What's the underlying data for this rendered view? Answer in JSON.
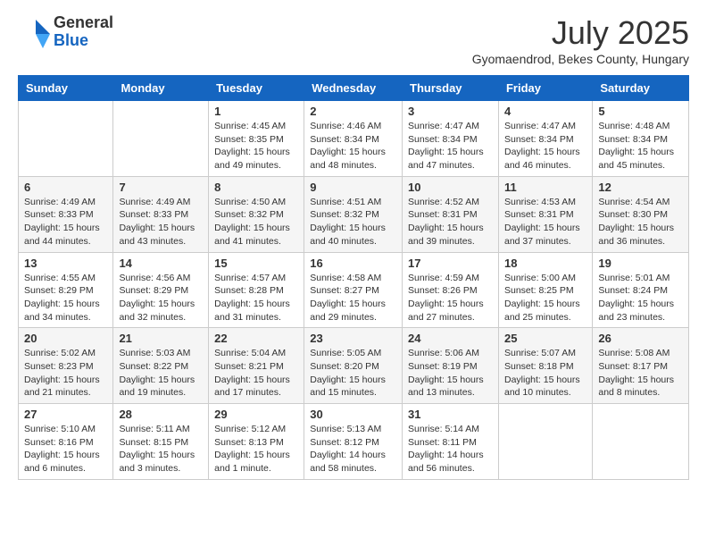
{
  "logo": {
    "general": "General",
    "blue": "Blue"
  },
  "title": "July 2025",
  "subtitle": "Gyomaendrod, Bekes County, Hungary",
  "weekdays": [
    "Sunday",
    "Monday",
    "Tuesday",
    "Wednesday",
    "Thursday",
    "Friday",
    "Saturday"
  ],
  "weeks": [
    [
      {
        "day": null
      },
      {
        "day": null
      },
      {
        "day": "1",
        "sunrise": "Sunrise: 4:45 AM",
        "sunset": "Sunset: 8:35 PM",
        "daylight": "Daylight: 15 hours and 49 minutes."
      },
      {
        "day": "2",
        "sunrise": "Sunrise: 4:46 AM",
        "sunset": "Sunset: 8:34 PM",
        "daylight": "Daylight: 15 hours and 48 minutes."
      },
      {
        "day": "3",
        "sunrise": "Sunrise: 4:47 AM",
        "sunset": "Sunset: 8:34 PM",
        "daylight": "Daylight: 15 hours and 47 minutes."
      },
      {
        "day": "4",
        "sunrise": "Sunrise: 4:47 AM",
        "sunset": "Sunset: 8:34 PM",
        "daylight": "Daylight: 15 hours and 46 minutes."
      },
      {
        "day": "5",
        "sunrise": "Sunrise: 4:48 AM",
        "sunset": "Sunset: 8:34 PM",
        "daylight": "Daylight: 15 hours and 45 minutes."
      }
    ],
    [
      {
        "day": "6",
        "sunrise": "Sunrise: 4:49 AM",
        "sunset": "Sunset: 8:33 PM",
        "daylight": "Daylight: 15 hours and 44 minutes."
      },
      {
        "day": "7",
        "sunrise": "Sunrise: 4:49 AM",
        "sunset": "Sunset: 8:33 PM",
        "daylight": "Daylight: 15 hours and 43 minutes."
      },
      {
        "day": "8",
        "sunrise": "Sunrise: 4:50 AM",
        "sunset": "Sunset: 8:32 PM",
        "daylight": "Daylight: 15 hours and 41 minutes."
      },
      {
        "day": "9",
        "sunrise": "Sunrise: 4:51 AM",
        "sunset": "Sunset: 8:32 PM",
        "daylight": "Daylight: 15 hours and 40 minutes."
      },
      {
        "day": "10",
        "sunrise": "Sunrise: 4:52 AM",
        "sunset": "Sunset: 8:31 PM",
        "daylight": "Daylight: 15 hours and 39 minutes."
      },
      {
        "day": "11",
        "sunrise": "Sunrise: 4:53 AM",
        "sunset": "Sunset: 8:31 PM",
        "daylight": "Daylight: 15 hours and 37 minutes."
      },
      {
        "day": "12",
        "sunrise": "Sunrise: 4:54 AM",
        "sunset": "Sunset: 8:30 PM",
        "daylight": "Daylight: 15 hours and 36 minutes."
      }
    ],
    [
      {
        "day": "13",
        "sunrise": "Sunrise: 4:55 AM",
        "sunset": "Sunset: 8:29 PM",
        "daylight": "Daylight: 15 hours and 34 minutes."
      },
      {
        "day": "14",
        "sunrise": "Sunrise: 4:56 AM",
        "sunset": "Sunset: 8:29 PM",
        "daylight": "Daylight: 15 hours and 32 minutes."
      },
      {
        "day": "15",
        "sunrise": "Sunrise: 4:57 AM",
        "sunset": "Sunset: 8:28 PM",
        "daylight": "Daylight: 15 hours and 31 minutes."
      },
      {
        "day": "16",
        "sunrise": "Sunrise: 4:58 AM",
        "sunset": "Sunset: 8:27 PM",
        "daylight": "Daylight: 15 hours and 29 minutes."
      },
      {
        "day": "17",
        "sunrise": "Sunrise: 4:59 AM",
        "sunset": "Sunset: 8:26 PM",
        "daylight": "Daylight: 15 hours and 27 minutes."
      },
      {
        "day": "18",
        "sunrise": "Sunrise: 5:00 AM",
        "sunset": "Sunset: 8:25 PM",
        "daylight": "Daylight: 15 hours and 25 minutes."
      },
      {
        "day": "19",
        "sunrise": "Sunrise: 5:01 AM",
        "sunset": "Sunset: 8:24 PM",
        "daylight": "Daylight: 15 hours and 23 minutes."
      }
    ],
    [
      {
        "day": "20",
        "sunrise": "Sunrise: 5:02 AM",
        "sunset": "Sunset: 8:23 PM",
        "daylight": "Daylight: 15 hours and 21 minutes."
      },
      {
        "day": "21",
        "sunrise": "Sunrise: 5:03 AM",
        "sunset": "Sunset: 8:22 PM",
        "daylight": "Daylight: 15 hours and 19 minutes."
      },
      {
        "day": "22",
        "sunrise": "Sunrise: 5:04 AM",
        "sunset": "Sunset: 8:21 PM",
        "daylight": "Daylight: 15 hours and 17 minutes."
      },
      {
        "day": "23",
        "sunrise": "Sunrise: 5:05 AM",
        "sunset": "Sunset: 8:20 PM",
        "daylight": "Daylight: 15 hours and 15 minutes."
      },
      {
        "day": "24",
        "sunrise": "Sunrise: 5:06 AM",
        "sunset": "Sunset: 8:19 PM",
        "daylight": "Daylight: 15 hours and 13 minutes."
      },
      {
        "day": "25",
        "sunrise": "Sunrise: 5:07 AM",
        "sunset": "Sunset: 8:18 PM",
        "daylight": "Daylight: 15 hours and 10 minutes."
      },
      {
        "day": "26",
        "sunrise": "Sunrise: 5:08 AM",
        "sunset": "Sunset: 8:17 PM",
        "daylight": "Daylight: 15 hours and 8 minutes."
      }
    ],
    [
      {
        "day": "27",
        "sunrise": "Sunrise: 5:10 AM",
        "sunset": "Sunset: 8:16 PM",
        "daylight": "Daylight: 15 hours and 6 minutes."
      },
      {
        "day": "28",
        "sunrise": "Sunrise: 5:11 AM",
        "sunset": "Sunset: 8:15 PM",
        "daylight": "Daylight: 15 hours and 3 minutes."
      },
      {
        "day": "29",
        "sunrise": "Sunrise: 5:12 AM",
        "sunset": "Sunset: 8:13 PM",
        "daylight": "Daylight: 15 hours and 1 minute."
      },
      {
        "day": "30",
        "sunrise": "Sunrise: 5:13 AM",
        "sunset": "Sunset: 8:12 PM",
        "daylight": "Daylight: 14 hours and 58 minutes."
      },
      {
        "day": "31",
        "sunrise": "Sunrise: 5:14 AM",
        "sunset": "Sunset: 8:11 PM",
        "daylight": "Daylight: 14 hours and 56 minutes."
      },
      {
        "day": null
      },
      {
        "day": null
      }
    ]
  ]
}
